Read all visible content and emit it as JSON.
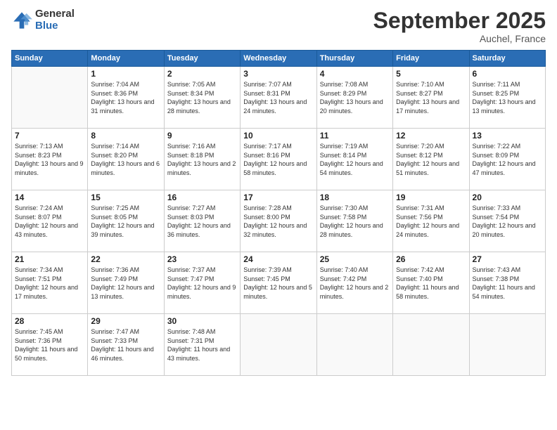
{
  "logo": {
    "general": "General",
    "blue": "Blue"
  },
  "header": {
    "month": "September 2025",
    "location": "Auchel, France"
  },
  "weekdays": [
    "Sunday",
    "Monday",
    "Tuesday",
    "Wednesday",
    "Thursday",
    "Friday",
    "Saturday"
  ],
  "weeks": [
    [
      {
        "day": "",
        "sunrise": "",
        "sunset": "",
        "daylight": ""
      },
      {
        "day": "1",
        "sunrise": "Sunrise: 7:04 AM",
        "sunset": "Sunset: 8:36 PM",
        "daylight": "Daylight: 13 hours and 31 minutes."
      },
      {
        "day": "2",
        "sunrise": "Sunrise: 7:05 AM",
        "sunset": "Sunset: 8:34 PM",
        "daylight": "Daylight: 13 hours and 28 minutes."
      },
      {
        "day": "3",
        "sunrise": "Sunrise: 7:07 AM",
        "sunset": "Sunset: 8:31 PM",
        "daylight": "Daylight: 13 hours and 24 minutes."
      },
      {
        "day": "4",
        "sunrise": "Sunrise: 7:08 AM",
        "sunset": "Sunset: 8:29 PM",
        "daylight": "Daylight: 13 hours and 20 minutes."
      },
      {
        "day": "5",
        "sunrise": "Sunrise: 7:10 AM",
        "sunset": "Sunset: 8:27 PM",
        "daylight": "Daylight: 13 hours and 17 minutes."
      },
      {
        "day": "6",
        "sunrise": "Sunrise: 7:11 AM",
        "sunset": "Sunset: 8:25 PM",
        "daylight": "Daylight: 13 hours and 13 minutes."
      }
    ],
    [
      {
        "day": "7",
        "sunrise": "Sunrise: 7:13 AM",
        "sunset": "Sunset: 8:23 PM",
        "daylight": "Daylight: 13 hours and 9 minutes."
      },
      {
        "day": "8",
        "sunrise": "Sunrise: 7:14 AM",
        "sunset": "Sunset: 8:20 PM",
        "daylight": "Daylight: 13 hours and 6 minutes."
      },
      {
        "day": "9",
        "sunrise": "Sunrise: 7:16 AM",
        "sunset": "Sunset: 8:18 PM",
        "daylight": "Daylight: 13 hours and 2 minutes."
      },
      {
        "day": "10",
        "sunrise": "Sunrise: 7:17 AM",
        "sunset": "Sunset: 8:16 PM",
        "daylight": "Daylight: 12 hours and 58 minutes."
      },
      {
        "day": "11",
        "sunrise": "Sunrise: 7:19 AM",
        "sunset": "Sunset: 8:14 PM",
        "daylight": "Daylight: 12 hours and 54 minutes."
      },
      {
        "day": "12",
        "sunrise": "Sunrise: 7:20 AM",
        "sunset": "Sunset: 8:12 PM",
        "daylight": "Daylight: 12 hours and 51 minutes."
      },
      {
        "day": "13",
        "sunrise": "Sunrise: 7:22 AM",
        "sunset": "Sunset: 8:09 PM",
        "daylight": "Daylight: 12 hours and 47 minutes."
      }
    ],
    [
      {
        "day": "14",
        "sunrise": "Sunrise: 7:24 AM",
        "sunset": "Sunset: 8:07 PM",
        "daylight": "Daylight: 12 hours and 43 minutes."
      },
      {
        "day": "15",
        "sunrise": "Sunrise: 7:25 AM",
        "sunset": "Sunset: 8:05 PM",
        "daylight": "Daylight: 12 hours and 39 minutes."
      },
      {
        "day": "16",
        "sunrise": "Sunrise: 7:27 AM",
        "sunset": "Sunset: 8:03 PM",
        "daylight": "Daylight: 12 hours and 36 minutes."
      },
      {
        "day": "17",
        "sunrise": "Sunrise: 7:28 AM",
        "sunset": "Sunset: 8:00 PM",
        "daylight": "Daylight: 12 hours and 32 minutes."
      },
      {
        "day": "18",
        "sunrise": "Sunrise: 7:30 AM",
        "sunset": "Sunset: 7:58 PM",
        "daylight": "Daylight: 12 hours and 28 minutes."
      },
      {
        "day": "19",
        "sunrise": "Sunrise: 7:31 AM",
        "sunset": "Sunset: 7:56 PM",
        "daylight": "Daylight: 12 hours and 24 minutes."
      },
      {
        "day": "20",
        "sunrise": "Sunrise: 7:33 AM",
        "sunset": "Sunset: 7:54 PM",
        "daylight": "Daylight: 12 hours and 20 minutes."
      }
    ],
    [
      {
        "day": "21",
        "sunrise": "Sunrise: 7:34 AM",
        "sunset": "Sunset: 7:51 PM",
        "daylight": "Daylight: 12 hours and 17 minutes."
      },
      {
        "day": "22",
        "sunrise": "Sunrise: 7:36 AM",
        "sunset": "Sunset: 7:49 PM",
        "daylight": "Daylight: 12 hours and 13 minutes."
      },
      {
        "day": "23",
        "sunrise": "Sunrise: 7:37 AM",
        "sunset": "Sunset: 7:47 PM",
        "daylight": "Daylight: 12 hours and 9 minutes."
      },
      {
        "day": "24",
        "sunrise": "Sunrise: 7:39 AM",
        "sunset": "Sunset: 7:45 PM",
        "daylight": "Daylight: 12 hours and 5 minutes."
      },
      {
        "day": "25",
        "sunrise": "Sunrise: 7:40 AM",
        "sunset": "Sunset: 7:42 PM",
        "daylight": "Daylight: 12 hours and 2 minutes."
      },
      {
        "day": "26",
        "sunrise": "Sunrise: 7:42 AM",
        "sunset": "Sunset: 7:40 PM",
        "daylight": "Daylight: 11 hours and 58 minutes."
      },
      {
        "day": "27",
        "sunrise": "Sunrise: 7:43 AM",
        "sunset": "Sunset: 7:38 PM",
        "daylight": "Daylight: 11 hours and 54 minutes."
      }
    ],
    [
      {
        "day": "28",
        "sunrise": "Sunrise: 7:45 AM",
        "sunset": "Sunset: 7:36 PM",
        "daylight": "Daylight: 11 hours and 50 minutes."
      },
      {
        "day": "29",
        "sunrise": "Sunrise: 7:47 AM",
        "sunset": "Sunset: 7:33 PM",
        "daylight": "Daylight: 11 hours and 46 minutes."
      },
      {
        "day": "30",
        "sunrise": "Sunrise: 7:48 AM",
        "sunset": "Sunset: 7:31 PM",
        "daylight": "Daylight: 11 hours and 43 minutes."
      },
      {
        "day": "",
        "sunrise": "",
        "sunset": "",
        "daylight": ""
      },
      {
        "day": "",
        "sunrise": "",
        "sunset": "",
        "daylight": ""
      },
      {
        "day": "",
        "sunrise": "",
        "sunset": "",
        "daylight": ""
      },
      {
        "day": "",
        "sunrise": "",
        "sunset": "",
        "daylight": ""
      }
    ]
  ]
}
